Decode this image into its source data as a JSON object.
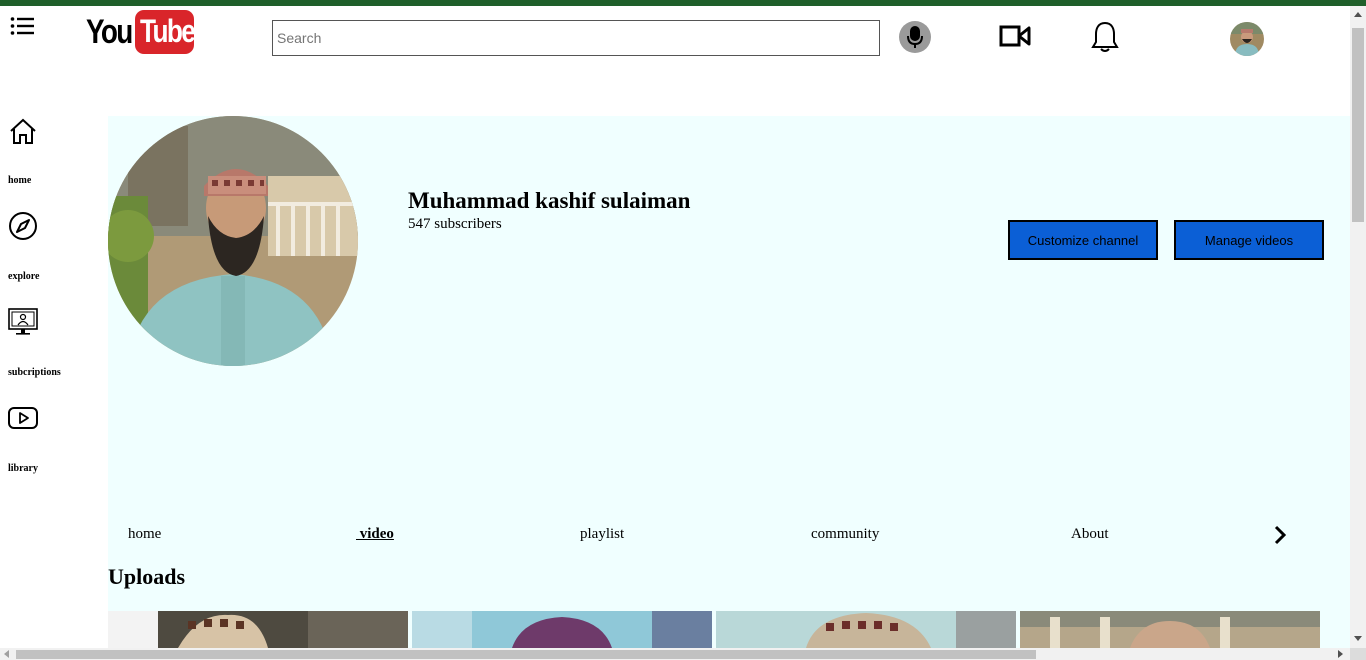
{
  "header": {
    "logo_you": "You",
    "logo_tube": "Tube",
    "search_placeholder": "Search",
    "brand_red": "#d9252a"
  },
  "sidebar": {
    "items": [
      {
        "label": "home",
        "icon": "home-icon"
      },
      {
        "label": "explore",
        "icon": "compass-icon"
      },
      {
        "label": "subcriptions",
        "icon": "subscriptions-icon"
      },
      {
        "label": "library",
        "icon": "play-icon"
      }
    ]
  },
  "channel": {
    "name": "Muhammad kashif sulaiman",
    "subscribers": "547 subscribers",
    "customize_label": "Customize channel",
    "manage_label": "Manage videos",
    "button_color": "#0b5fd6",
    "background": "#f0ffff"
  },
  "tabs": [
    {
      "label": "home",
      "active": false
    },
    {
      "label": " video",
      "active": true
    },
    {
      "label": "playlist",
      "active": false
    },
    {
      "label": "community",
      "active": false
    },
    {
      "label": "About",
      "active": false
    }
  ],
  "uploads_title": "Uploads",
  "thumbnails_count": 4
}
